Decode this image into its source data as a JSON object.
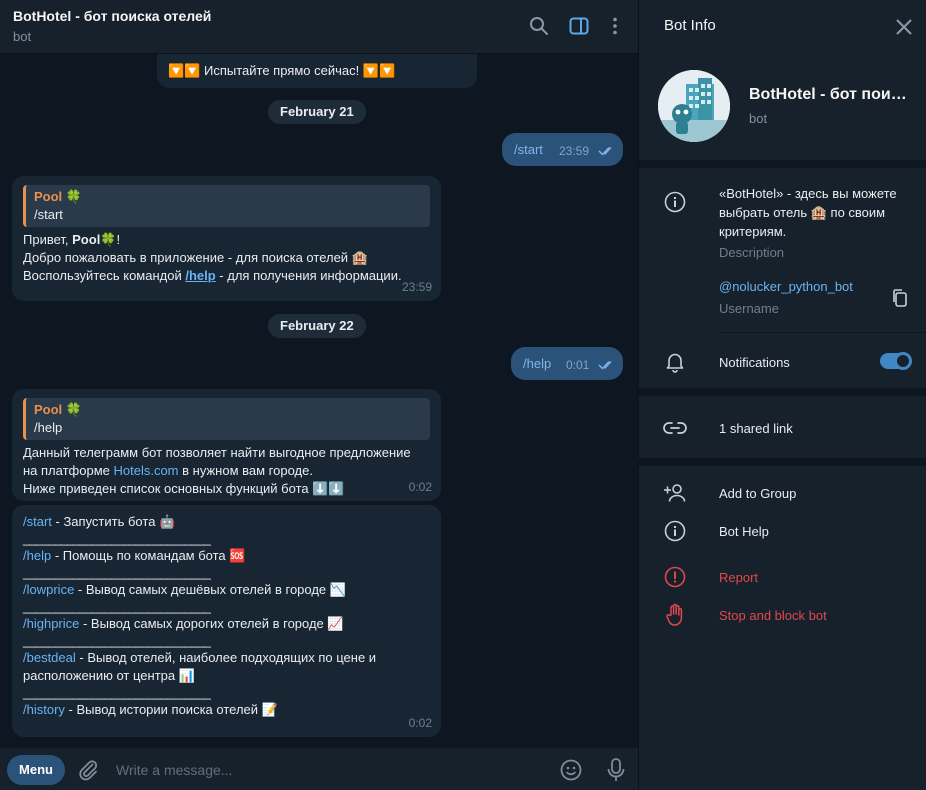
{
  "header": {
    "title": "BotHotel - бот поиска отелей",
    "subtitle": "bot"
  },
  "messages": {
    "top_cut_text": "🔽🔽 Испытайте прямо сейчас! 🔽🔽",
    "date1": "February 21",
    "out1": {
      "text": "/start",
      "time": "23:59"
    },
    "in1": {
      "quote_name": "Pool 🍀",
      "quote_text": "/start",
      "greet_prefix": "Привет, ",
      "greet_name": "Pool",
      "greet_suffix": "🍀!",
      "line2": "Добро пожаловать в приложение - для поиска отелей 🏨",
      "line3_prefix": "Воспользуйтесь командой ",
      "line3_link": "/help",
      "line3_suffix": " - для получения информации.",
      "time": "23:59"
    },
    "date2": "February 22",
    "out2": {
      "text": "/help",
      "time": "0:01"
    },
    "in2": {
      "quote_name": "Pool 🍀",
      "quote_text": "/help",
      "line1": "Данный телеграмм бот позволяет найти выгодное предложение",
      "line2_prefix": "на платформе ",
      "line2_link": "Hotels.com",
      "line2_suffix": " в нужном вам городе.",
      "line3": "Ниже приведен список основных функций бота ⬇️⬇️",
      "time": "0:02"
    },
    "in3": {
      "separator": "______________________________",
      "commands": [
        {
          "cmd": "/start",
          "desc": " - Запустить бота 🤖"
        },
        {
          "cmd": "/help",
          "desc": " - Помощь по командам бота 🆘"
        },
        {
          "cmd": "/lowprice",
          "desc": " - Вывод самых дешёвых отелей в городе 📉"
        },
        {
          "cmd": "/highprice",
          "desc": " - Вывод самых дорогих отелей в городе 📈"
        },
        {
          "cmd": "/bestdeal",
          "desc": " - Вывод отелей, наиболее подходящих по цене и",
          "desc2": "расположению от центра 📊"
        },
        {
          "cmd": "/history",
          "desc": " - Вывод истории поиска отелей 📝"
        }
      ],
      "time": "0:02"
    }
  },
  "composer": {
    "menu_label": "Menu",
    "placeholder": "Write a message..."
  },
  "panel": {
    "title": "Bot Info",
    "bot_name": "BotHotel - бот поиска отелей",
    "bot_type": "bot",
    "description": "«BotHotel» - здесь вы можете выбрать отель 🏨 по своим критериям.",
    "description_label": "Description",
    "username": "@nolucker_python_bot",
    "username_label": "Username",
    "notifications_label": "Notifications",
    "notifications_on": true,
    "shared_link": "1 shared link",
    "add_to_group": "Add to Group",
    "bot_help": "Bot Help",
    "report": "Report",
    "stop_block": "Stop and block bot"
  },
  "colors": {
    "accent": "#6ab3f3",
    "toggle": "#3f88c5",
    "danger": "#e0474f",
    "quote": "#e8914c",
    "out_bubble": "#2b5278"
  }
}
